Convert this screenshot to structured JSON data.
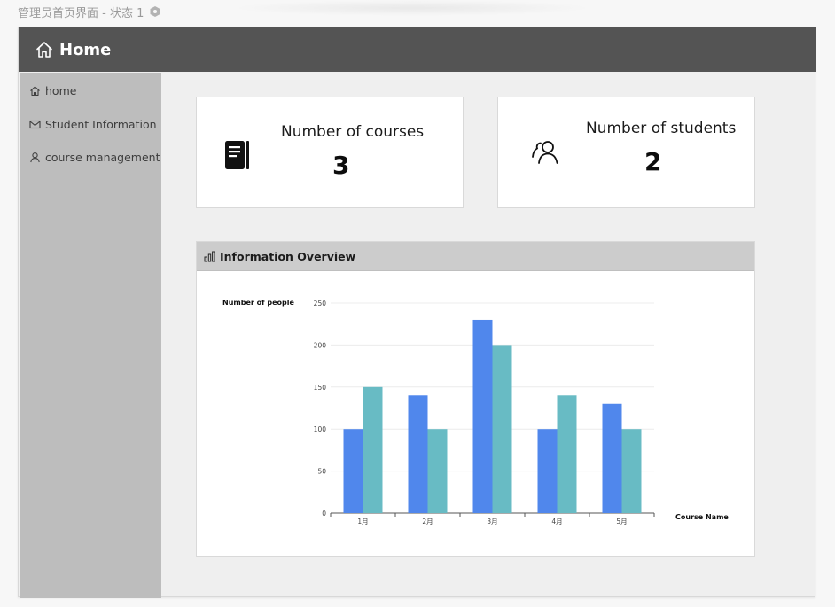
{
  "page": {
    "title": "管理员首页界面 - 状态 1"
  },
  "header": {
    "title": "Home",
    "icon": "home-icon"
  },
  "sidebar": {
    "items": [
      {
        "label": "home",
        "icon": "home-icon"
      },
      {
        "label": "Student Information",
        "icon": "mail-icon"
      },
      {
        "label": "course management",
        "icon": "user-icon"
      }
    ]
  },
  "stats": {
    "courses": {
      "label": "Number of courses",
      "value": "3",
      "icon": "book-icon"
    },
    "students": {
      "label": "Number of students",
      "value": "2",
      "icon": "users-icon"
    }
  },
  "overview": {
    "title": "Information Overview",
    "icon": "bar-chart-icon"
  },
  "colors": {
    "header_bg": "#545454",
    "sidebar_bg": "#bdbdbd",
    "series_1": "#5087ec",
    "series_2": "#68bbc4"
  },
  "chart_data": {
    "type": "bar",
    "categories": [
      "1月",
      "2月",
      "3月",
      "4月",
      "5月"
    ],
    "series": [
      {
        "values": [
          100,
          140,
          230,
          100,
          130
        ]
      },
      {
        "values": [
          150,
          100,
          200,
          140,
          100
        ]
      }
    ],
    "ylabel": "Number of people",
    "xlabel": "Course Name",
    "ylim": [
      0,
      250
    ],
    "yticks": [
      0,
      50,
      100,
      150,
      200,
      250
    ],
    "grid": true
  }
}
